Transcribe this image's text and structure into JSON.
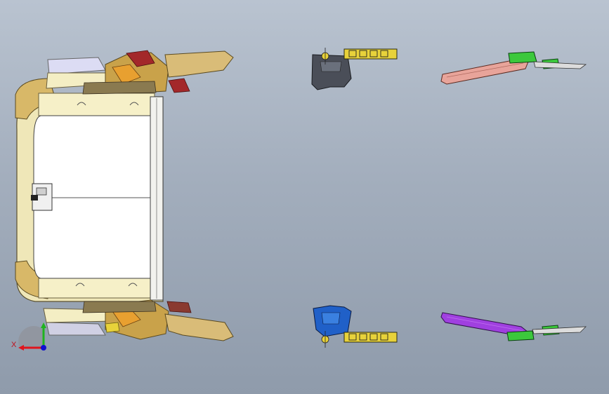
{
  "window": {
    "background": [
      "#b9c3d0",
      "#8f9bab"
    ]
  },
  "triad": {
    "x_label": "X",
    "x_color": "#e0141c",
    "y_color": "#1fb41f",
    "z_color": "#1010d0"
  },
  "parts": [
    {
      "name": "seat-frame-assembly",
      "colors": [
        "#f7f1c9",
        "#c9a24a",
        "#a3282a",
        "#e0a030"
      ]
    },
    {
      "name": "bracket-top-dark",
      "colors": [
        "#4a4e58",
        "#e8d23a"
      ]
    },
    {
      "name": "bracket-bottom-blue",
      "colors": [
        "#2060c8",
        "#e8d23a"
      ]
    },
    {
      "name": "rail-top-pink",
      "colors": [
        "#e8a49a",
        "#3cc83c"
      ]
    },
    {
      "name": "rail-bottom-purple",
      "colors": [
        "#a040e0",
        "#3cc83c"
      ]
    }
  ]
}
